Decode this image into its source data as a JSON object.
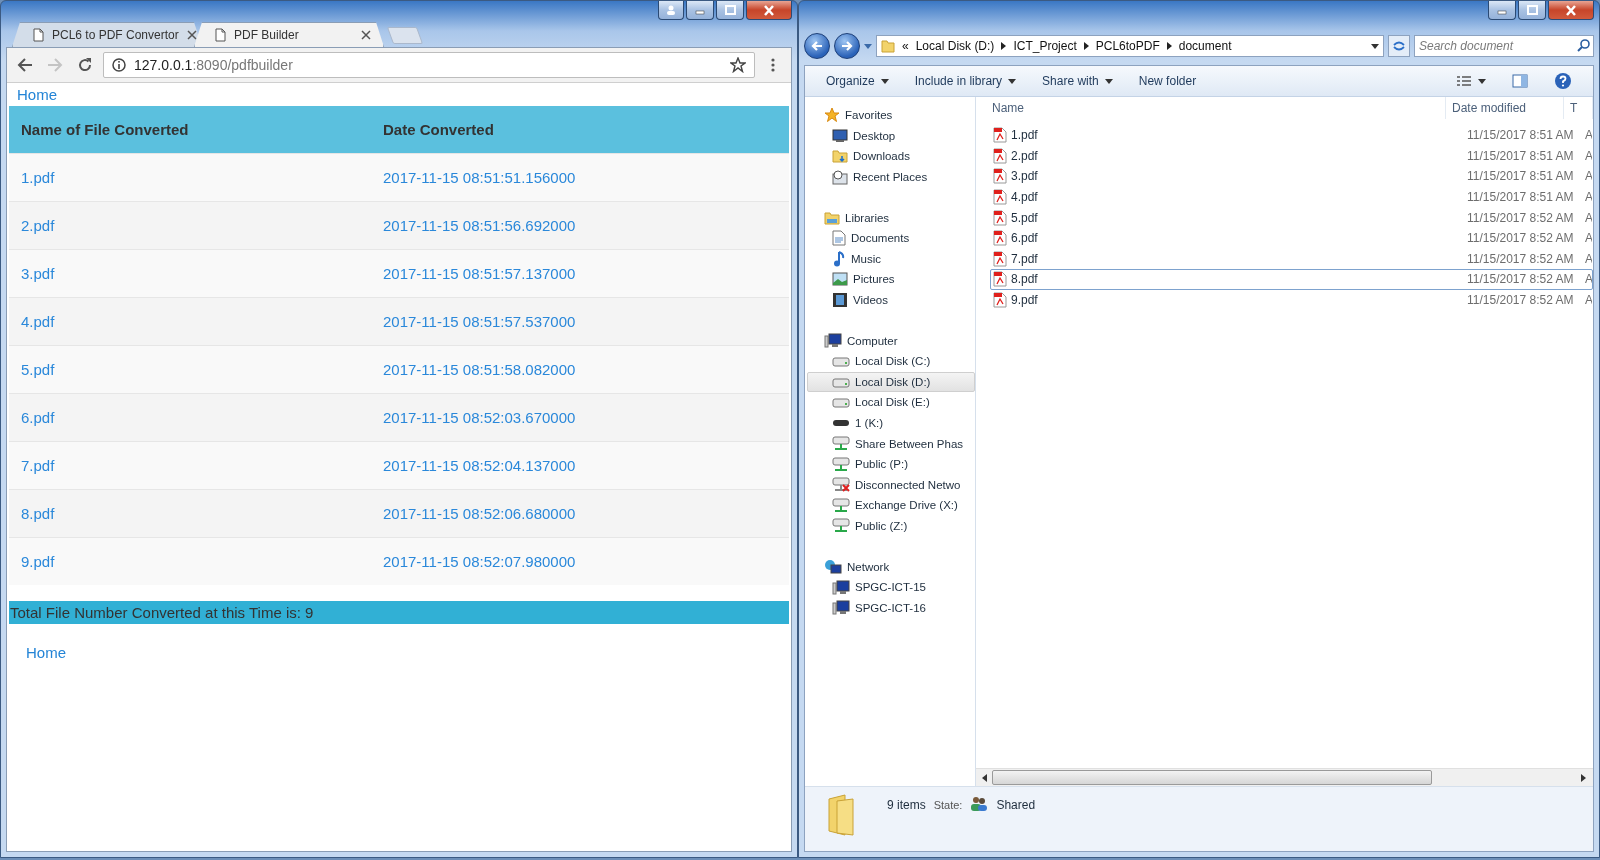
{
  "browser": {
    "tabs": [
      {
        "title": "PCL6 to PDF Convertor",
        "selected": false
      },
      {
        "title": "PDF Builder",
        "selected": true
      }
    ],
    "address": {
      "host": "127.0.0.1",
      "path": ":8090/pdfbuilder"
    },
    "page": {
      "top_link": "Home",
      "table": {
        "columns": [
          "Name of File Converted",
          "Date Converted"
        ],
        "rows": [
          [
            "1.pdf",
            "2017-11-15 08:51:51.156000"
          ],
          [
            "2.pdf",
            "2017-11-15 08:51:56.692000"
          ],
          [
            "3.pdf",
            "2017-11-15 08:51:57.137000"
          ],
          [
            "4.pdf",
            "2017-11-15 08:51:57.537000"
          ],
          [
            "5.pdf",
            "2017-11-15 08:51:58.082000"
          ],
          [
            "6.pdf",
            "2017-11-15 08:52:03.670000"
          ],
          [
            "7.pdf",
            "2017-11-15 08:52:04.137000"
          ],
          [
            "8.pdf",
            "2017-11-15 08:52:06.680000"
          ],
          [
            "9.pdf",
            "2017-11-15 08:52:07.980000"
          ]
        ]
      },
      "total": "Total File Number Converted at this Time is: 9",
      "bottom_link": "Home"
    }
  },
  "explorer": {
    "breadcrumb": {
      "overflow": "«",
      "parts": [
        "Local Disk (D:)",
        "ICT_Project",
        "PCL6toPDF",
        "document"
      ]
    },
    "search": {
      "placeholder": "Search document"
    },
    "toolbar": [
      {
        "label": "Organize",
        "dropdown": true
      },
      {
        "label": "Include in library",
        "dropdown": true
      },
      {
        "label": "Share with",
        "dropdown": true
      },
      {
        "label": "New folder",
        "dropdown": false
      }
    ],
    "nav": [
      {
        "label": "Favorites",
        "kind": "star",
        "selected": false,
        "children": [
          {
            "label": "Desktop",
            "kind": "desktop",
            "selected": false
          },
          {
            "label": "Downloads",
            "kind": "folder",
            "selected": false
          },
          {
            "label": "Recent Places",
            "kind": "recent",
            "selected": false
          }
        ]
      },
      {
        "label": "Libraries",
        "kind": "library",
        "selected": false,
        "children": [
          {
            "label": "Documents",
            "kind": "document",
            "selected": false
          },
          {
            "label": "Music",
            "kind": "music",
            "selected": false
          },
          {
            "label": "Pictures",
            "kind": "pictures",
            "selected": false
          },
          {
            "label": "Videos",
            "kind": "video",
            "selected": false
          }
        ]
      },
      {
        "label": "Computer",
        "kind": "computer",
        "selected": false,
        "children": [
          {
            "label": "Local Disk (C:)",
            "kind": "drive",
            "selected": false
          },
          {
            "label": "Local Disk (D:)",
            "kind": "drive",
            "selected": true
          },
          {
            "label": "Local Disk (E:)",
            "kind": "drive",
            "selected": false
          },
          {
            "label": "1 (K:)",
            "kind": "removable",
            "selected": false
          },
          {
            "label": "Share Between Phas",
            "kind": "netdrive",
            "selected": false
          },
          {
            "label": "Public (P:)",
            "kind": "netdrive",
            "selected": false
          },
          {
            "label": "Disconnected Netwo",
            "kind": "disconnected",
            "selected": false
          },
          {
            "label": "Exchange Drive (X:)",
            "kind": "netdrive",
            "selected": false
          },
          {
            "label": "Public (Z:)",
            "kind": "netdrive",
            "selected": false
          }
        ]
      },
      {
        "label": "Network",
        "kind": "network",
        "selected": false,
        "children": [
          {
            "label": "SPGC-ICT-15",
            "kind": "computer",
            "selected": false
          },
          {
            "label": "SPGC-ICT-16",
            "kind": "computer",
            "selected": false
          }
        ]
      }
    ],
    "columns": [
      "Name",
      "Date modified",
      "T"
    ],
    "files": [
      {
        "name": "1.pdf",
        "date": "11/15/2017 8:51 AM",
        "column_3": "A",
        "selected": false
      },
      {
        "name": "2.pdf",
        "date": "11/15/2017 8:51 AM",
        "column_3": "A",
        "selected": false
      },
      {
        "name": "3.pdf",
        "date": "11/15/2017 8:51 AM",
        "column_3": "A",
        "selected": false
      },
      {
        "name": "4.pdf",
        "date": "11/15/2017 8:51 AM",
        "column_3": "A",
        "selected": false
      },
      {
        "name": "5.pdf",
        "date": "11/15/2017 8:52 AM",
        "column_3": "A",
        "selected": false
      },
      {
        "name": "6.pdf",
        "date": "11/15/2017 8:52 AM",
        "column_3": "A",
        "selected": false
      },
      {
        "name": "7.pdf",
        "date": "11/15/2017 8:52 AM",
        "column_3": "A",
        "selected": false
      },
      {
        "name": "8.pdf",
        "date": "11/15/2017 8:52 AM",
        "column_3": "A",
        "selected": true
      },
      {
        "name": "9.pdf",
        "date": "11/15/2017 8:52 AM",
        "column_3": "A",
        "selected": false
      }
    ],
    "status": {
      "count": "9 items",
      "state_label": "State:",
      "state": "Shared"
    }
  }
}
